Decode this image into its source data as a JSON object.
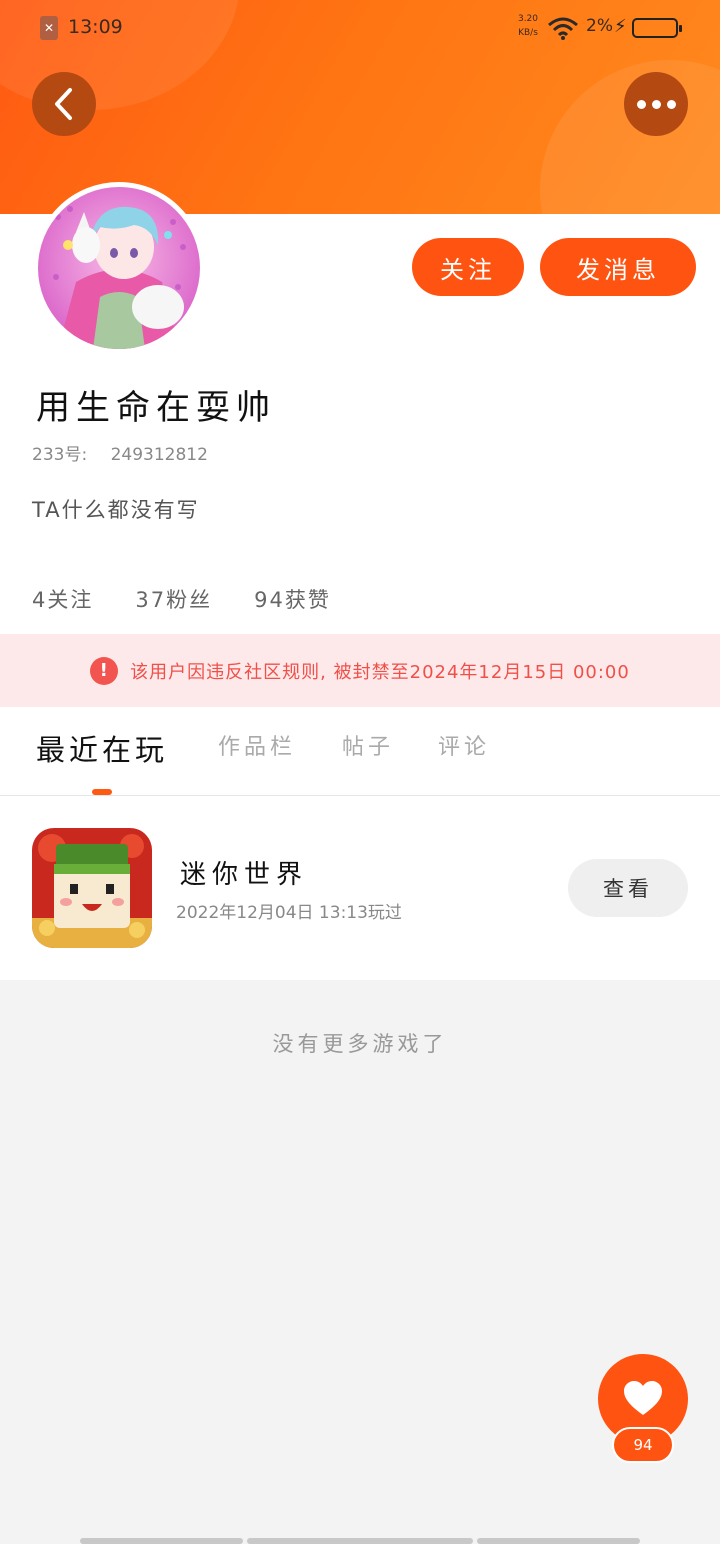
{
  "status_bar": {
    "time": "13:09",
    "net_speed_value": "3.20",
    "net_speed_unit": "KB/s",
    "battery_percent": "2%"
  },
  "header": {
    "back_icon": "chevron-left-icon",
    "more_icon": "more-dots-icon",
    "accent_color": "#ff5a12"
  },
  "profile": {
    "nickname": "用生命在耍帅",
    "account_label": "233号:",
    "account_id": "249312812",
    "bio": "TA什么都没有写",
    "follow_button": "关注",
    "message_button": "发消息",
    "stats": {
      "following": "4关注",
      "fans": "37粉丝",
      "likes": "94获赞"
    }
  },
  "ban_notice": {
    "text": "该用户因违反社区规则, 被封禁至2024年12月15日 00:00",
    "icon": "alert-icon",
    "color": "#f0504a"
  },
  "tabs": [
    {
      "label": "最近在玩",
      "active": true
    },
    {
      "label": "作品栏",
      "active": false
    },
    {
      "label": "帖子",
      "active": false
    },
    {
      "label": "评论",
      "active": false
    }
  ],
  "games": [
    {
      "name": "迷你世界",
      "played_at": "2022年12月04日 13:13玩过",
      "action": "查看"
    }
  ],
  "empty_hint": "没有更多游戏了",
  "like_fab": {
    "icon": "heart-icon",
    "count": "94"
  }
}
